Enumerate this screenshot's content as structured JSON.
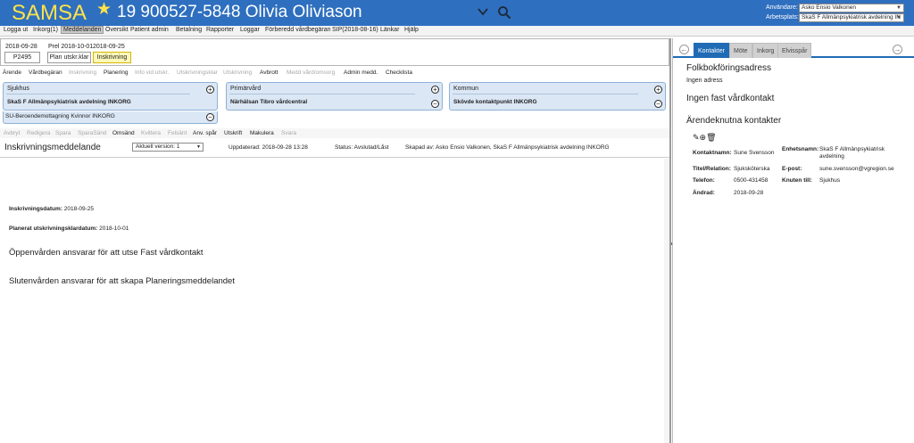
{
  "header": {
    "logo": "SAMSA",
    "patient": "19 900527-5848 Olivia Oliviason",
    "user_label": "Användare:",
    "user_value": "Asko Ensio Valkonen",
    "workplace_label": "Arbetsplats:",
    "workplace_value": "SkaS F Allmänpsykiatrisk avdelning IN"
  },
  "menu": [
    "Logga ut",
    "Inkorg(1)",
    "Meddelanden",
    "Översikt",
    "Patient admin",
    "Betalning",
    "Rapporter",
    "Loggar",
    "Förberedd vårdbegäran",
    "SIP(2018-08-16)",
    "Länkar",
    "Hjälp"
  ],
  "timeline": {
    "d1": "2018-09-28",
    "b1": "P2495",
    "d2": "Prel 2018-10-01",
    "b2": "Plan utskr.klar",
    "d3": "2018-09-25",
    "b3": "Inskrivning"
  },
  "actions1": [
    {
      "label": "Ärende",
      "enabled": true
    },
    {
      "label": "Vårdbegäran",
      "enabled": true
    },
    {
      "label": "Inskrivning",
      "enabled": false
    },
    {
      "label": "Planering",
      "enabled": true
    },
    {
      "label": "Info vid utskr.",
      "enabled": false
    },
    {
      "label": "Utskrivningsklar",
      "enabled": false
    },
    {
      "label": "Utskrivning",
      "enabled": false
    },
    {
      "label": "Avbrott",
      "enabled": true
    },
    {
      "label": "Medd vård/omsorg",
      "enabled": false
    },
    {
      "label": "Admin medd.",
      "enabled": true
    },
    {
      "label": "Checklista",
      "enabled": true
    }
  ],
  "care": {
    "hospital": {
      "title": "Sjukhus",
      "value": "SkaS F Allmänpsykiatrisk avdelning INKORG",
      "extra": "SU-Beroendemottagning Kvinnor INKORG"
    },
    "primary": {
      "title": "Primärvård",
      "value": "Närhälsan Tibro vårdcentral"
    },
    "municipality": {
      "title": "Kommun",
      "value": "Skövde kontaktpunkt INKORG"
    }
  },
  "actions2": [
    {
      "label": "Avbryt",
      "enabled": false
    },
    {
      "label": "Redigera",
      "enabled": false
    },
    {
      "label": "Spara",
      "enabled": false
    },
    {
      "label": "SparaSänd",
      "enabled": false
    },
    {
      "label": "Omsänd",
      "enabled": true
    },
    {
      "label": "Kvittera",
      "enabled": false
    },
    {
      "label": "Felsänt",
      "enabled": false
    },
    {
      "label": "Anv. spår",
      "enabled": true
    },
    {
      "label": "Utskrift",
      "enabled": true
    },
    {
      "label": "Makulera",
      "enabled": true
    },
    {
      "label": "Svara",
      "enabled": false
    }
  ],
  "message": {
    "title": "Inskrivningsmeddelande",
    "version": "Aktuell version: 1",
    "updated": "Uppdaterad: 2018-09-28 13:28",
    "status": "Status: Avslutad/Låst",
    "created": "Skapad av: Asko Ensio Valkonen, SkaS F Allmänpsykiatrisk avdelning INKORG",
    "f1_label": "Inskrivningsdatum:",
    "f1_value": "2018-09-25",
    "f2_label": "Planerat utskrivningsklardatum:",
    "f2_value": "2018-10-01",
    "p1": "Öppenvården ansvarar för att utse Fast vårdkontakt",
    "p2": "Slutenvården ansvarar för att skapa Planeringsmeddelandet"
  },
  "right": {
    "tabs": [
      "Kontakter",
      "Möte",
      "Inkorg",
      "Elvisspår"
    ],
    "h1": "Folkbokföringsadress",
    "h1_sub": "Ingen adress",
    "h2": "Ingen fast vårdkontakt",
    "h3": "Ärendeknutna kontakter",
    "contact": {
      "name_label": "Kontaktnamn:",
      "name": "Sune Svensson",
      "unit_label": "Enhetsnamn:",
      "unit_l1": "SkaS F Allmänpsykiatrisk",
      "unit_l2": "avdelning",
      "title_label": "Titel/Relation:",
      "title": "Sjuksköterska",
      "email_label": "E-post:",
      "email": "sune.svensson@vgregion.se",
      "phone_label": "Telefon:",
      "phone": "0500-431458",
      "link_label": "Knuten till:",
      "link": "Sjukhus",
      "changed_label": "Ändrad:",
      "changed": "2018-09-28"
    }
  }
}
